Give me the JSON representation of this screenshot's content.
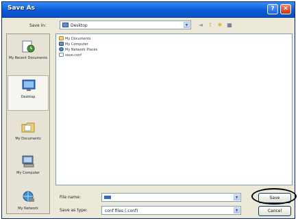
{
  "window": {
    "title": "Save As",
    "help_label": "?",
    "close_label": "✕"
  },
  "save_in": {
    "label": "Save in:",
    "value": "Desktop"
  },
  "places": [
    {
      "label": "My Recent Documents",
      "icon": "recent-documents-icon",
      "selected": false
    },
    {
      "label": "Desktop",
      "icon": "desktop-icon",
      "selected": true
    },
    {
      "label": "My Documents",
      "icon": "my-documents-icon",
      "selected": false
    },
    {
      "label": "My Computer",
      "icon": "my-computer-icon",
      "selected": false
    },
    {
      "label": "My Network",
      "icon": "my-network-icon",
      "selected": false
    }
  ],
  "files": [
    {
      "name": "My Documents",
      "icon": "folder-icon"
    },
    {
      "name": "My Computer",
      "icon": "computer-icon"
    },
    {
      "name": "My Network Places",
      "icon": "network-icon"
    },
    {
      "name": "save.conf",
      "icon": "file-icon"
    }
  ],
  "file_name": {
    "label": "File name:",
    "value": ""
  },
  "save_as_type": {
    "label": "Save as type:",
    "value": "conf files (.conf)"
  },
  "buttons": {
    "save": "Save",
    "cancel": "Cancel"
  },
  "colors": {
    "titlebar": "#0a5bd6",
    "dialog": "#ece9d8",
    "highlight_circle": "#000000"
  }
}
